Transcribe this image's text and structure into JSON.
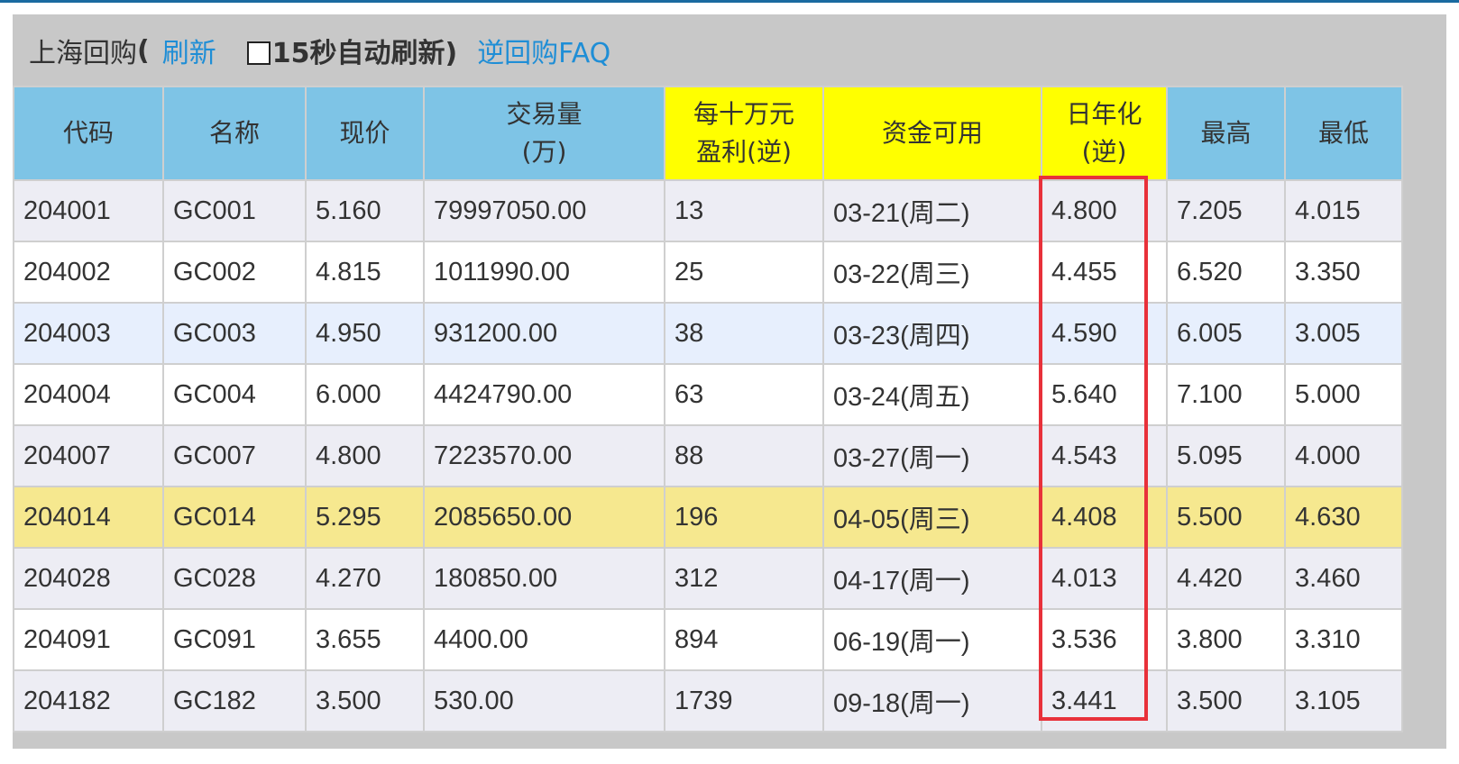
{
  "header": {
    "title": "上海回购",
    "paren_open": "(",
    "refresh_link": "刷新",
    "auto_refresh_label": "15秒自动刷新)",
    "faq_link": "逆回购FAQ"
  },
  "table": {
    "columns": [
      {
        "label": "代码"
      },
      {
        "label": "名称"
      },
      {
        "label": "现价"
      },
      {
        "label": "交易量",
        "label2": "(万)"
      },
      {
        "label": "每十万元",
        "label2": "盈利(逆)"
      },
      {
        "label": "资金可用"
      },
      {
        "label": "日年化",
        "label2": "(逆)"
      },
      {
        "label": "最高"
      },
      {
        "label": "最低"
      }
    ],
    "rows": [
      {
        "code": "204001",
        "name": "GC001",
        "price": "5.160",
        "volume": "79997050.00",
        "profit": "13",
        "available": "03-21(周二)",
        "annual": "4.800",
        "high": "7.205",
        "low": "4.015"
      },
      {
        "code": "204002",
        "name": "GC002",
        "price": "4.815",
        "volume": "1011990.00",
        "profit": "25",
        "available": "03-22(周三)",
        "annual": "4.455",
        "high": "6.520",
        "low": "3.350"
      },
      {
        "code": "204003",
        "name": "GC003",
        "price": "4.950",
        "volume": "931200.00",
        "profit": "38",
        "available": "03-23(周四)",
        "annual": "4.590",
        "high": "6.005",
        "low": "3.005"
      },
      {
        "code": "204004",
        "name": "GC004",
        "price": "6.000",
        "volume": "4424790.00",
        "profit": "63",
        "available": "03-24(周五)",
        "annual": "5.640",
        "high": "7.100",
        "low": "5.000"
      },
      {
        "code": "204007",
        "name": "GC007",
        "price": "4.800",
        "volume": "7223570.00",
        "profit": "88",
        "available": "03-27(周一)",
        "annual": "4.543",
        "high": "5.095",
        "low": "4.000"
      },
      {
        "code": "204014",
        "name": "GC014",
        "price": "5.295",
        "volume": "2085650.00",
        "profit": "196",
        "available": "04-05(周三)",
        "annual": "4.408",
        "high": "5.500",
        "low": "4.630"
      },
      {
        "code": "204028",
        "name": "GC028",
        "price": "4.270",
        "volume": "180850.00",
        "profit": "312",
        "available": "04-17(周一)",
        "annual": "4.013",
        "high": "4.420",
        "low": "3.460"
      },
      {
        "code": "204091",
        "name": "GC091",
        "price": "3.655",
        "volume": "4400.00",
        "profit": "894",
        "available": "06-19(周一)",
        "annual": "3.536",
        "high": "3.800",
        "low": "3.310"
      },
      {
        "code": "204182",
        "name": "GC182",
        "price": "3.500",
        "volume": "530.00",
        "profit": "1739",
        "available": "09-18(周一)",
        "annual": "3.441",
        "high": "3.500",
        "low": "3.105"
      }
    ]
  },
  "colors": {
    "header_blue": "#7ec4e6",
    "header_yellow": "#ffff00",
    "highlight_row": "#f6e88f",
    "link": "#1f8ed6",
    "annotation_red": "#e8313a"
  }
}
